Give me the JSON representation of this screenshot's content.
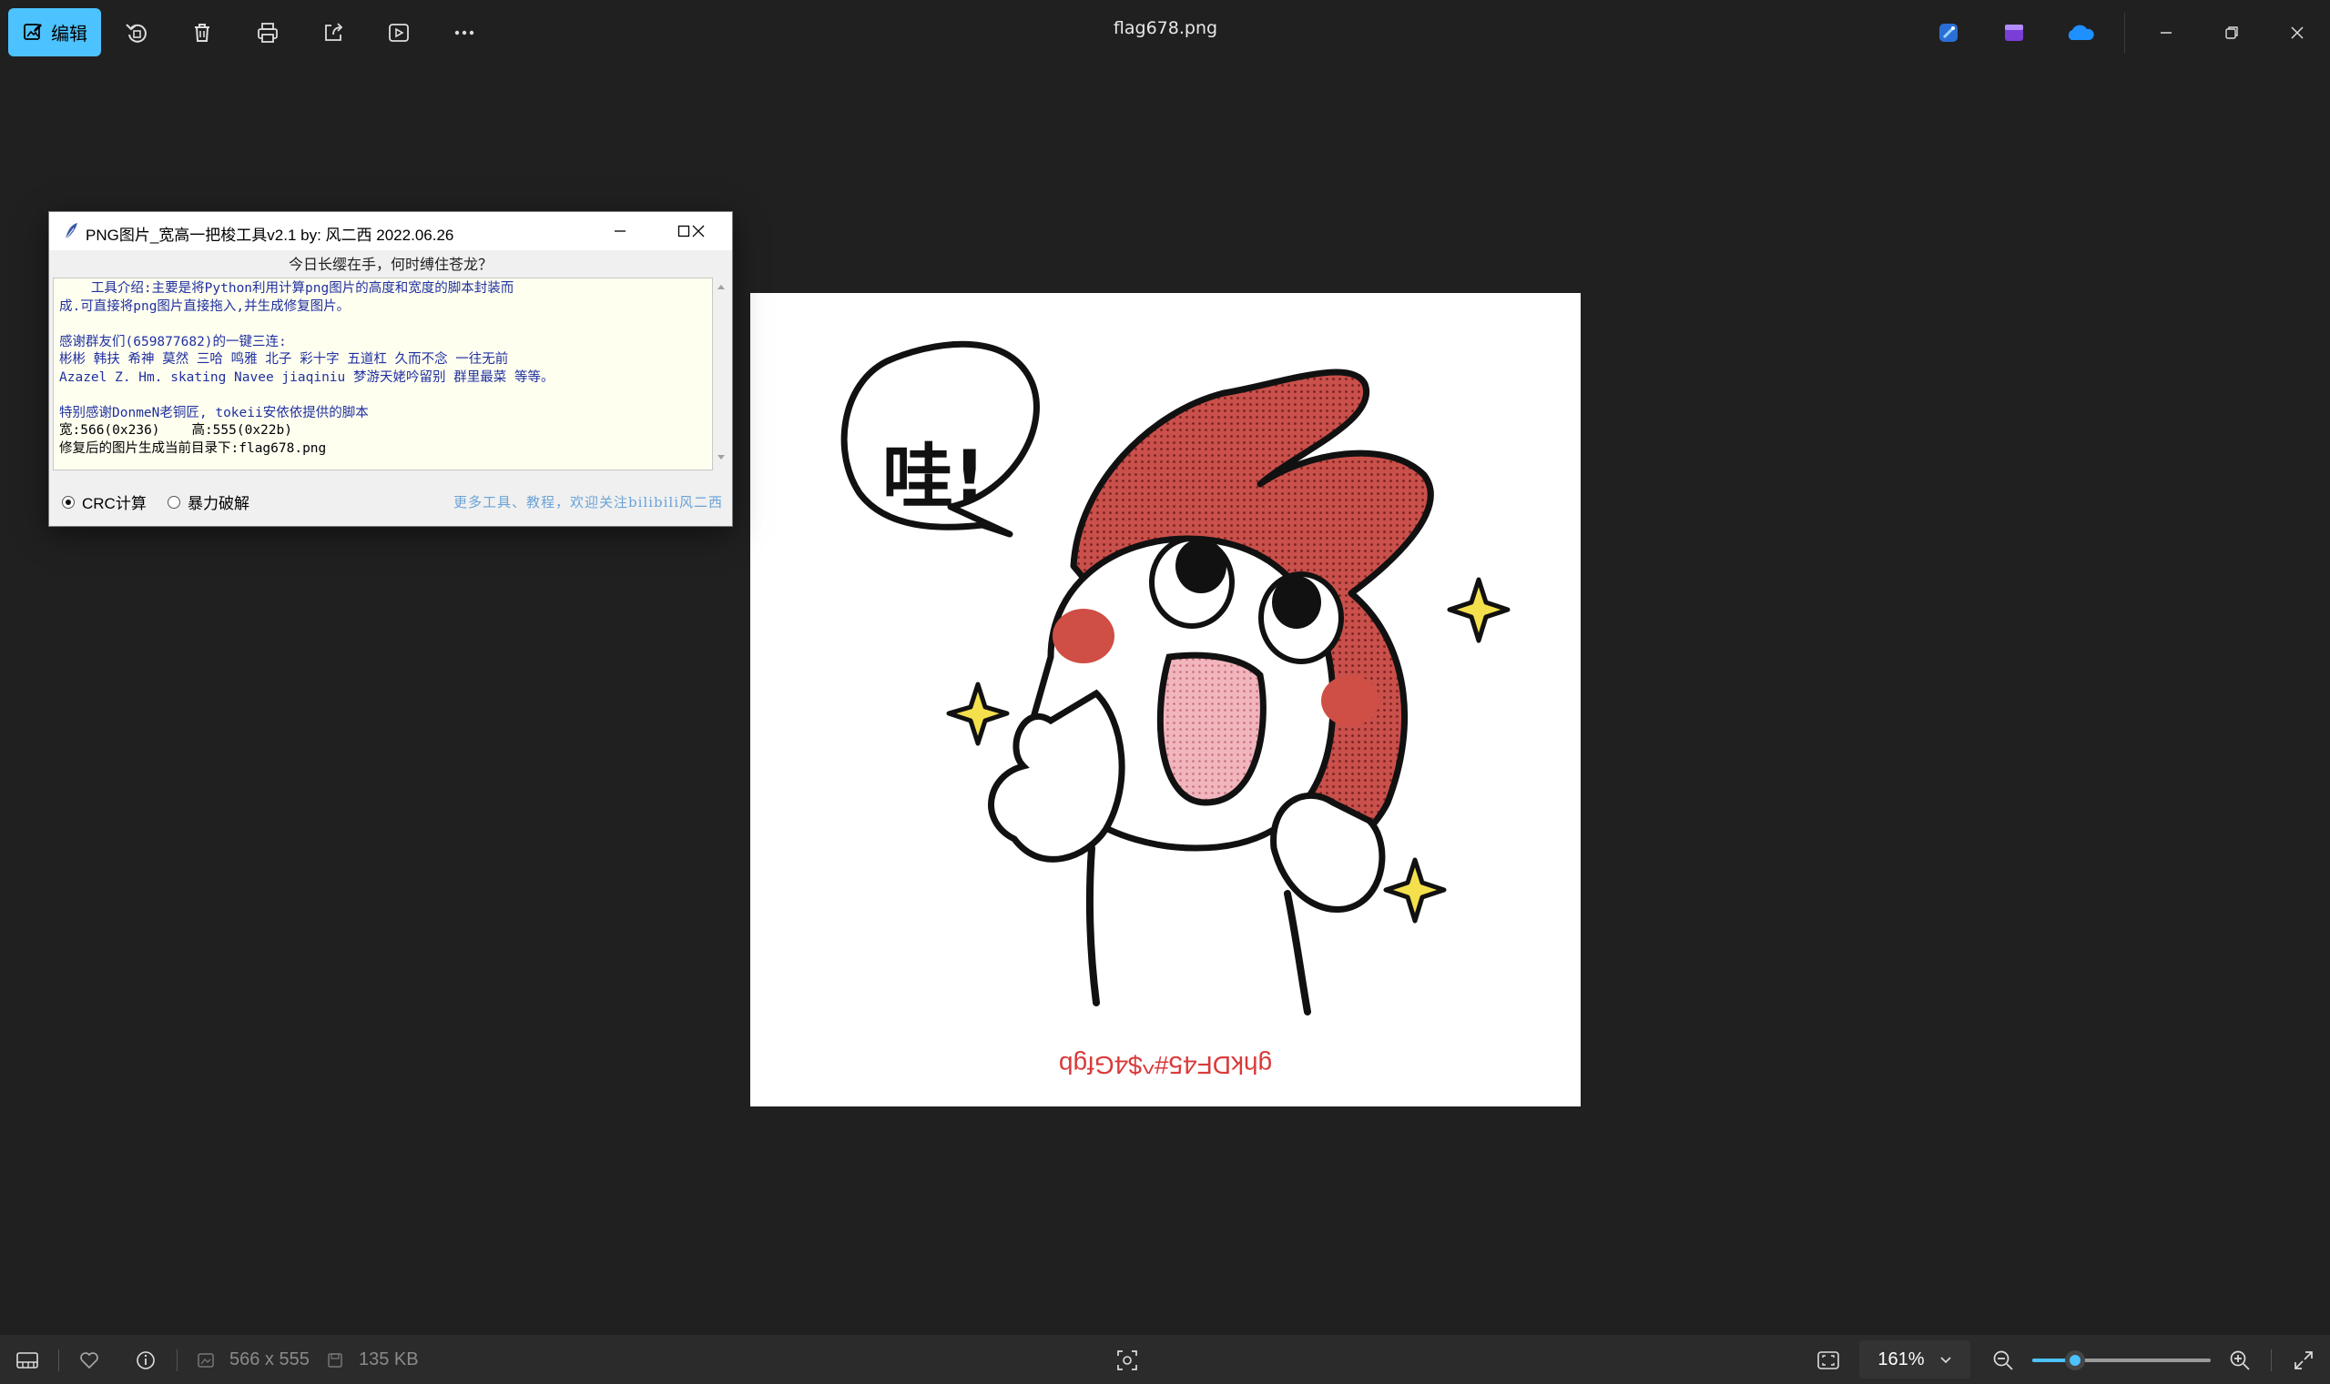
{
  "toolbar": {
    "edit_label": "编辑",
    "icons": [
      "rotate-icon",
      "delete-icon",
      "print-icon",
      "share-icon",
      "slideshow-icon",
      "more-icon"
    ]
  },
  "window": {
    "title": "flag678.png",
    "apps": [
      "designer-icon",
      "clipchamp-icon",
      "onedrive-icon"
    ]
  },
  "image": {
    "flipped_text": "ghkDF45#^$4Gfgb",
    "speech_text": "哇!"
  },
  "tool": {
    "title": "PNG图片_宽高一把梭工具v2.1   by: 风二西 2022.06.26",
    "subtitle": "今日长缨在手，何时缚住苍龙？",
    "line1": "    工具介绍:主要是将Python利用计算png图片的高度和宽度的脚本封装而",
    "line2": "成.可直接将png图片直接拖入,并生成修复图片。",
    "line3": "感谢群友们(659877682)的一键三连:",
    "line4": "彬彬 韩扶 希神 莫然 三哈 鸣雅 北子 彩十字 五道杠 久而不念 一往无前",
    "line5": "Azazel Z. Hm. skating Navee jiaqiniu 梦游天姥吟留别 群里最菜 等等。",
    "line6": "特别感谢DonmeN老铜匠, tokeii安依依提供的脚本",
    "line7": "宽:566(0x236)    高:555(0x22b)",
    "line8": "修复后的图片生成当前目录下:flag678.png",
    "radio1": "CRC计算",
    "radio2": "暴力破解",
    "radio_selected": "CRC计算",
    "footer_link": "更多工具、教程，欢迎关注bilibili风二西"
  },
  "statusbar": {
    "dimensions": "566 x 555",
    "filesize": "135 KB",
    "zoom": "161%",
    "zoom_fraction": 0.24
  },
  "colors": {
    "accent": "#4cc2ff",
    "background": "#202020",
    "flag_text": "#d93a3a"
  }
}
